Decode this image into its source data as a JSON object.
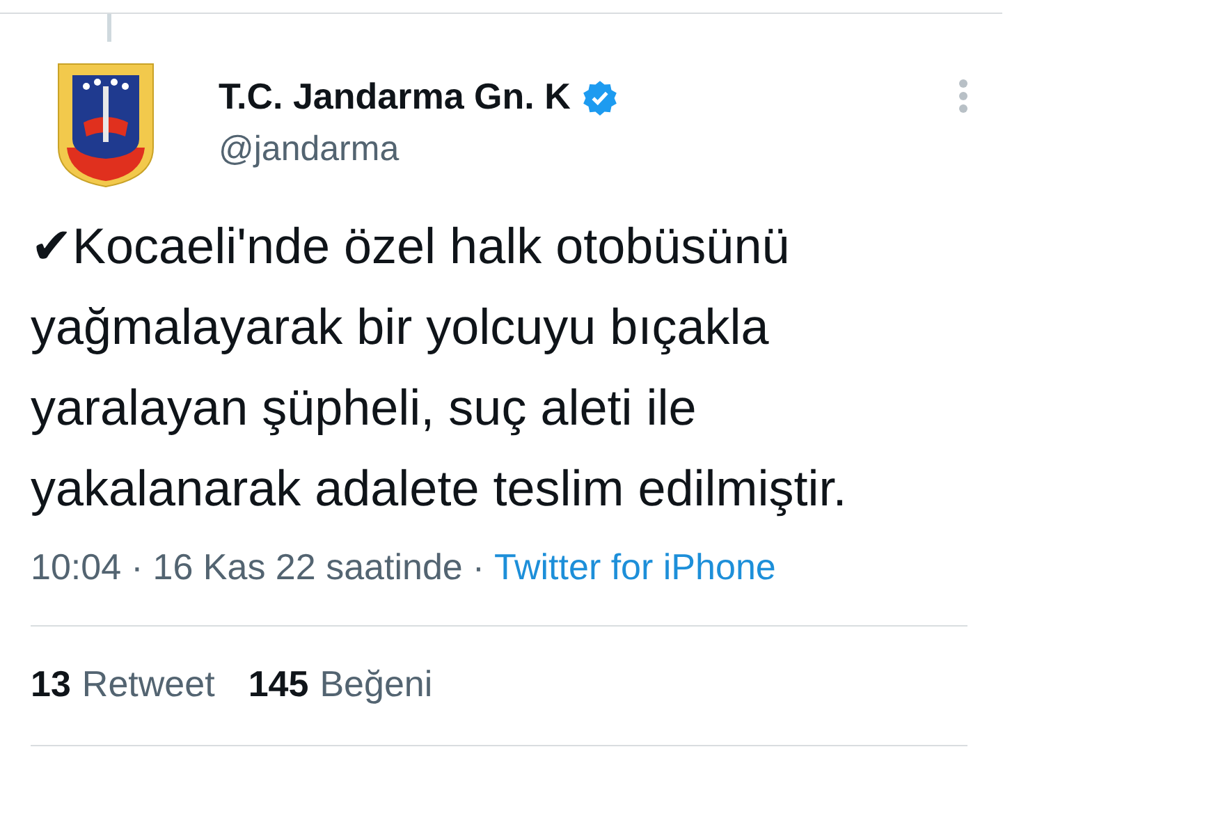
{
  "author": {
    "name": "T.C. Jandarma Gn. K",
    "handle": "@jandarma",
    "verified": true
  },
  "text": "✔Kocaeli'nde özel halk otobüsünü yağmalayarak bir yolcuyu bıçakla yaralayan şüpheli, suç aleti ile yakalanarak adalete teslim edilmiştir.",
  "meta": {
    "time": "10:04",
    "separator_1": "·",
    "date": "16 Kas 22 saatinde",
    "separator_2": "·",
    "source": "Twitter for iPhone"
  },
  "stats": [
    {
      "count": "13",
      "label": "Retweet"
    },
    {
      "count": "145",
      "label": "Beğeni"
    }
  ]
}
